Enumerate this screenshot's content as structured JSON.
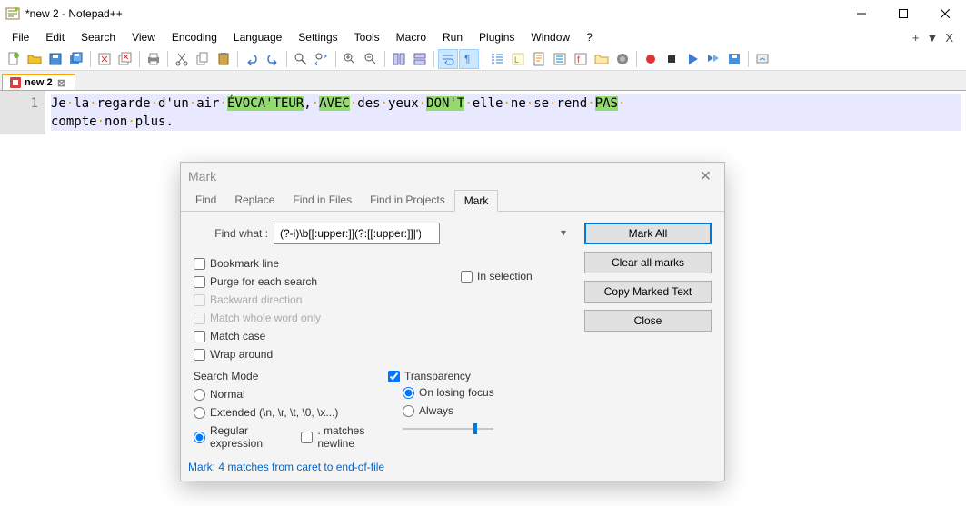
{
  "window": {
    "title": "*new 2 - Notepad++"
  },
  "menu": {
    "items": [
      "File",
      "Edit",
      "Search",
      "View",
      "Encoding",
      "Language",
      "Settings",
      "Tools",
      "Macro",
      "Run",
      "Plugins",
      "Window",
      "?"
    ],
    "right": [
      "+",
      "▼",
      "X"
    ]
  },
  "tab": {
    "name": "new 2"
  },
  "editor": {
    "line_no": "1",
    "words": [
      "Je",
      "la",
      "regarde",
      "d'un",
      "air"
    ],
    "hl1": "ÉVOCA'TEUR",
    "after_hl1": ",",
    "hl2": "AVEC",
    "words2": [
      "des",
      "yeux"
    ],
    "hl3": "DON'T",
    "words3": [
      "elle",
      "ne",
      "se",
      "rend"
    ],
    "hl4": "PAS",
    "line2_words": [
      "compte",
      "non",
      "plus."
    ]
  },
  "dialog": {
    "title": "Mark",
    "tabs": {
      "find": "Find",
      "replace": "Replace",
      "fif": "Find in Files",
      "fip": "Find in Projects",
      "mark": "Mark"
    },
    "find_label": "Find what :",
    "find_value": "(?-i)\\b[[:upper:]](?:[[:upper:]]|')+\\b",
    "checks": {
      "bookmark": "Bookmark line",
      "purge": "Purge for each search",
      "backward": "Backward direction",
      "whole": "Match whole word only",
      "case": "Match case",
      "wrap": "Wrap around"
    },
    "in_selection": "In selection",
    "buttons": {
      "mark_all": "Mark All",
      "clear": "Clear all marks",
      "copy": "Copy Marked Text",
      "close": "Close"
    },
    "search_mode": {
      "label": "Search Mode",
      "normal": "Normal",
      "extended": "Extended (\\n, \\r, \\t, \\0, \\x...)",
      "regex": "Regular expression",
      "newline": ". matches newline"
    },
    "transparency": {
      "label": "Transparency",
      "onlose": "On losing focus",
      "always": "Always"
    },
    "status": "Mark: 4 matches from caret to end-of-file"
  }
}
